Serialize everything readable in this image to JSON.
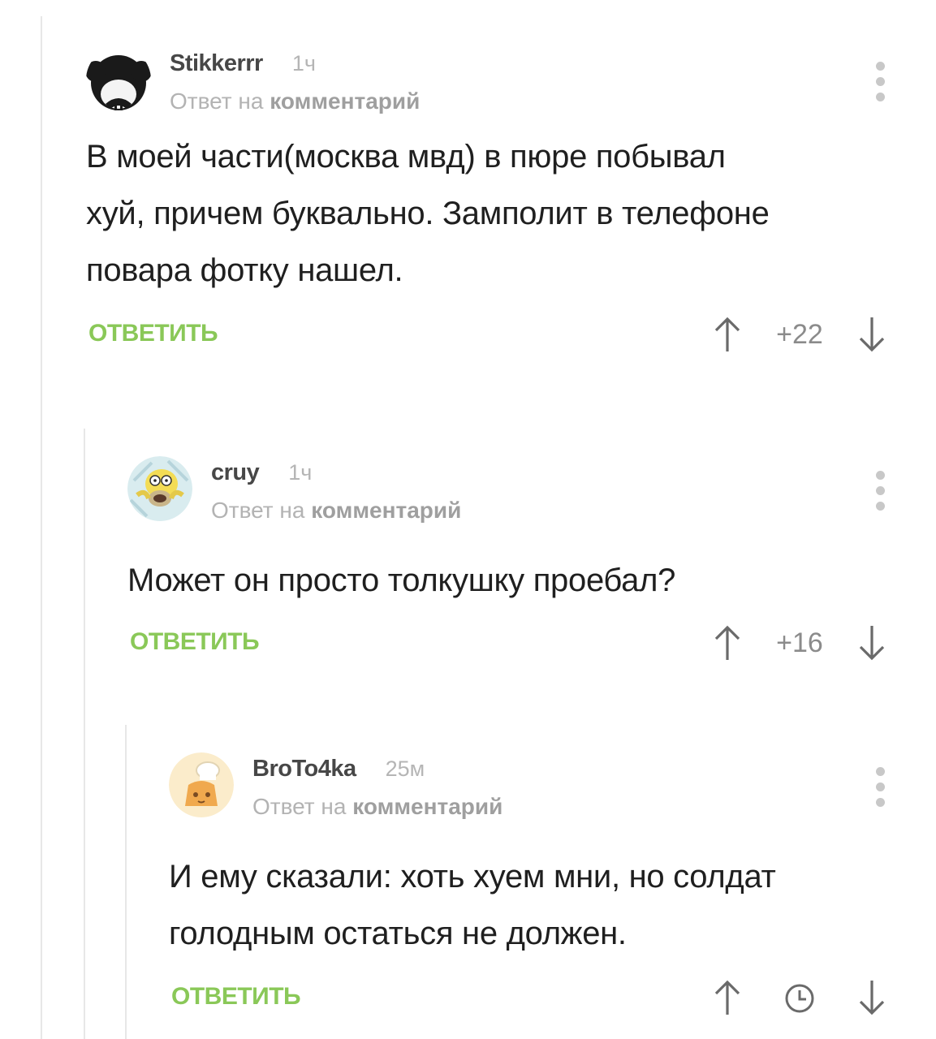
{
  "comments": [
    {
      "author": "Stikkerrr",
      "time": "1ч",
      "reply_prefix": "Ответ на",
      "reply_link": "комментарий",
      "text_lines": [
        "В моей части(москва мвд) в пюре побывал",
        "хуй, причем буквально. Замполит в телефоне",
        "повара фотку нашел."
      ],
      "reply_label": "ОТВЕТИТЬ",
      "score": "+22",
      "avatar_icon": "mickey-mouse-avatar"
    },
    {
      "author": "cruy",
      "time": "1ч",
      "reply_prefix": "Ответ на",
      "reply_link": "комментарий",
      "text_lines": [
        "Может он просто толкушку проебал?"
      ],
      "reply_label": "ОТВЕТИТЬ",
      "score": "+16",
      "avatar_icon": "homer-simpson-avatar"
    },
    {
      "author": "BroTo4ka",
      "time": "25м",
      "reply_prefix": "Ответ на",
      "reply_link": "комментарий",
      "text_lines": [
        "И ему сказали: хоть хуем мни, но солдат",
        "голодным остаться не должен."
      ],
      "reply_label": "ОТВЕТИТЬ",
      "score_icon": "clock-icon",
      "avatar_icon": "chef-avatar"
    }
  ],
  "colors": {
    "accent_green": "#8ac858",
    "meta_gray": "#b3b3b3",
    "thread_line": "#e7e7e7"
  }
}
